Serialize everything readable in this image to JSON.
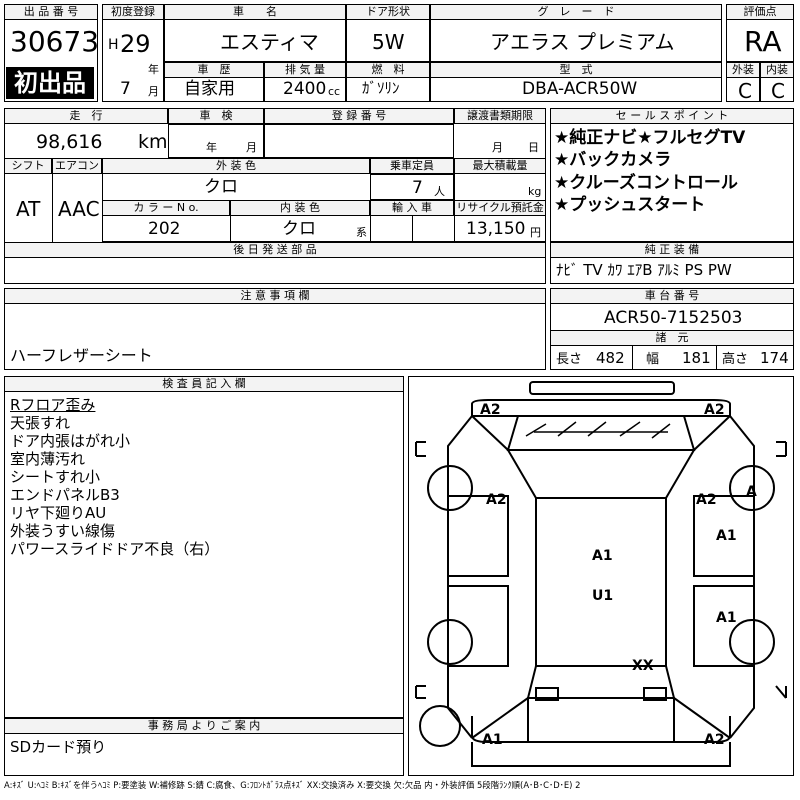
{
  "header": {
    "lot_number_label": "出 品 番 号",
    "lot_number": "30673",
    "first_listing_badge": "初出品",
    "first_reg_label": "初度登録",
    "era": "H",
    "year": "29",
    "year_unit": "年",
    "month": "7",
    "month_unit": "月",
    "car_name_label": "車　　名",
    "car_name": "エスティマ",
    "door_label": "ドア形状",
    "door": "5W",
    "grade_label": "グ　レ　ー　ド",
    "grade": "アエラス プレミアム",
    "score_label": "評価点",
    "score": "RA",
    "history_label": "車　歴",
    "history": "自家用",
    "displacement_label": "排 気 量",
    "displacement": "2400",
    "displacement_unit": "cc",
    "fuel_label": "燃　料",
    "fuel": "ｶﾞｿﾘﾝ",
    "model_label": "型　式",
    "model": "DBA-ACR50W",
    "exterior_label": "外装",
    "exterior_grade": "C",
    "interior_label": "内装",
    "interior_grade": "C"
  },
  "specs": {
    "mileage_label": "走　行",
    "mileage": "98,616",
    "mileage_unit": "km",
    "inspection_label": "車　検",
    "inspection_year_unit": "年",
    "inspection_month_unit": "月",
    "registration_label": "登 録 番 号",
    "transfer_label": "譲渡書類期限",
    "transfer_month_unit": "月",
    "transfer_day_unit": "日",
    "shift_label": "シフト",
    "shift": "AT",
    "ac_label": "エアコン",
    "ac": "AAC",
    "color_label": "外 装 色",
    "color": "クロ",
    "capacity_label": "乗車定員",
    "capacity": "7",
    "capacity_unit": "人",
    "load_label": "最大積載量",
    "load_unit": "kg",
    "color_no_label": "カ ラ ー  N o.",
    "color_no": "202",
    "interior_color_label": "内 装 色",
    "interior_color": "クロ",
    "interior_color_unit": "系",
    "import_label": "輸 入 車",
    "recycle_label": "リサイクル預託金",
    "recycle": "13,150",
    "recycle_unit": "円"
  },
  "sales_points": {
    "label": "セ ー ル ス ポ イ ン ト",
    "items": [
      "★純正ナビ★フルセグTV",
      "★バックカメラ",
      "★クルーズコントロール",
      "★プッシュスタート"
    ]
  },
  "later_parts_label": "後 日 発 送 部 品",
  "equipment": {
    "label": "純 正 装 備",
    "value": "ﾅﾋﾞ TV ｶﾜ ｴｱB ｱﾙﾐ PS PW"
  },
  "notes": {
    "label": "注 意 事 項 欄",
    "value": "ハーフレザーシート"
  },
  "chassis": {
    "label": "車 台 番 号",
    "value": "ACR50-7152503",
    "dims_label": "諸　元",
    "length_label": "長さ",
    "length": "482",
    "width_label": "幅",
    "width": "181",
    "height_label": "高さ",
    "height": "174"
  },
  "inspector": {
    "label": "検 査 員 記 入 欄",
    "lines": [
      "Rフロア歪み",
      "天張すれ",
      "ドア内張はがれ小",
      "室内薄汚れ",
      "シートすれ小",
      "エンドパネルB3",
      "リヤ下廻りAU",
      "外装うすい線傷",
      "パワースライドドア不良（右）"
    ]
  },
  "office": {
    "label": "事 務 局 よ り ご 案 内",
    "value": "SDカード預り"
  },
  "diagram_marks": {
    "front_left_corner": "A2",
    "front_right_corner": "A2",
    "right_front_fender": "A2",
    "right_front_wheel": "A",
    "right_front_door": "A1",
    "roof": "A1",
    "body_center": "U1",
    "right_rear_door": "A1",
    "rear_body": "XX",
    "rear_left_corner": "A1",
    "rear_right_corner": "A2"
  },
  "legend": "A:ｷｽﾞ U:ﾍｺﾐ B:ｷｽﾞを伴うﾍｺﾐ P:要塗装 W:補修跡 S:錆 C:腐食、G:ﾌﾛﾝﾄｶﾞﾗｽ点ｷｽﾞ XX:交換済み X:要交換 欠:欠品 内・外装評価 5段階ﾗﾝｸ順(A･B･C･D･E) 2"
}
